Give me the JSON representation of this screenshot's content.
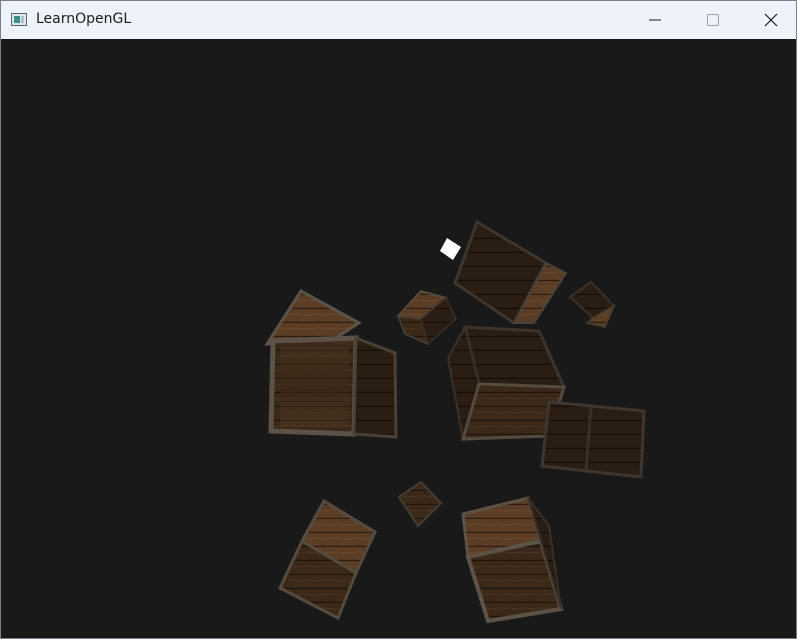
{
  "window": {
    "title": "LearnOpenGL",
    "icons": {
      "app": "app-window-icon",
      "minimize": "minimize-icon",
      "maximize": "maximize-icon",
      "close": "close-icon"
    }
  },
  "scene": {
    "background": "#191919",
    "crate_colors": {
      "wood_dark": "#2e2116",
      "wood_mid": "#4a3420",
      "wood_light": "#6a4a2e",
      "frame": "#5c5248"
    },
    "light_color": "#ffffff"
  }
}
